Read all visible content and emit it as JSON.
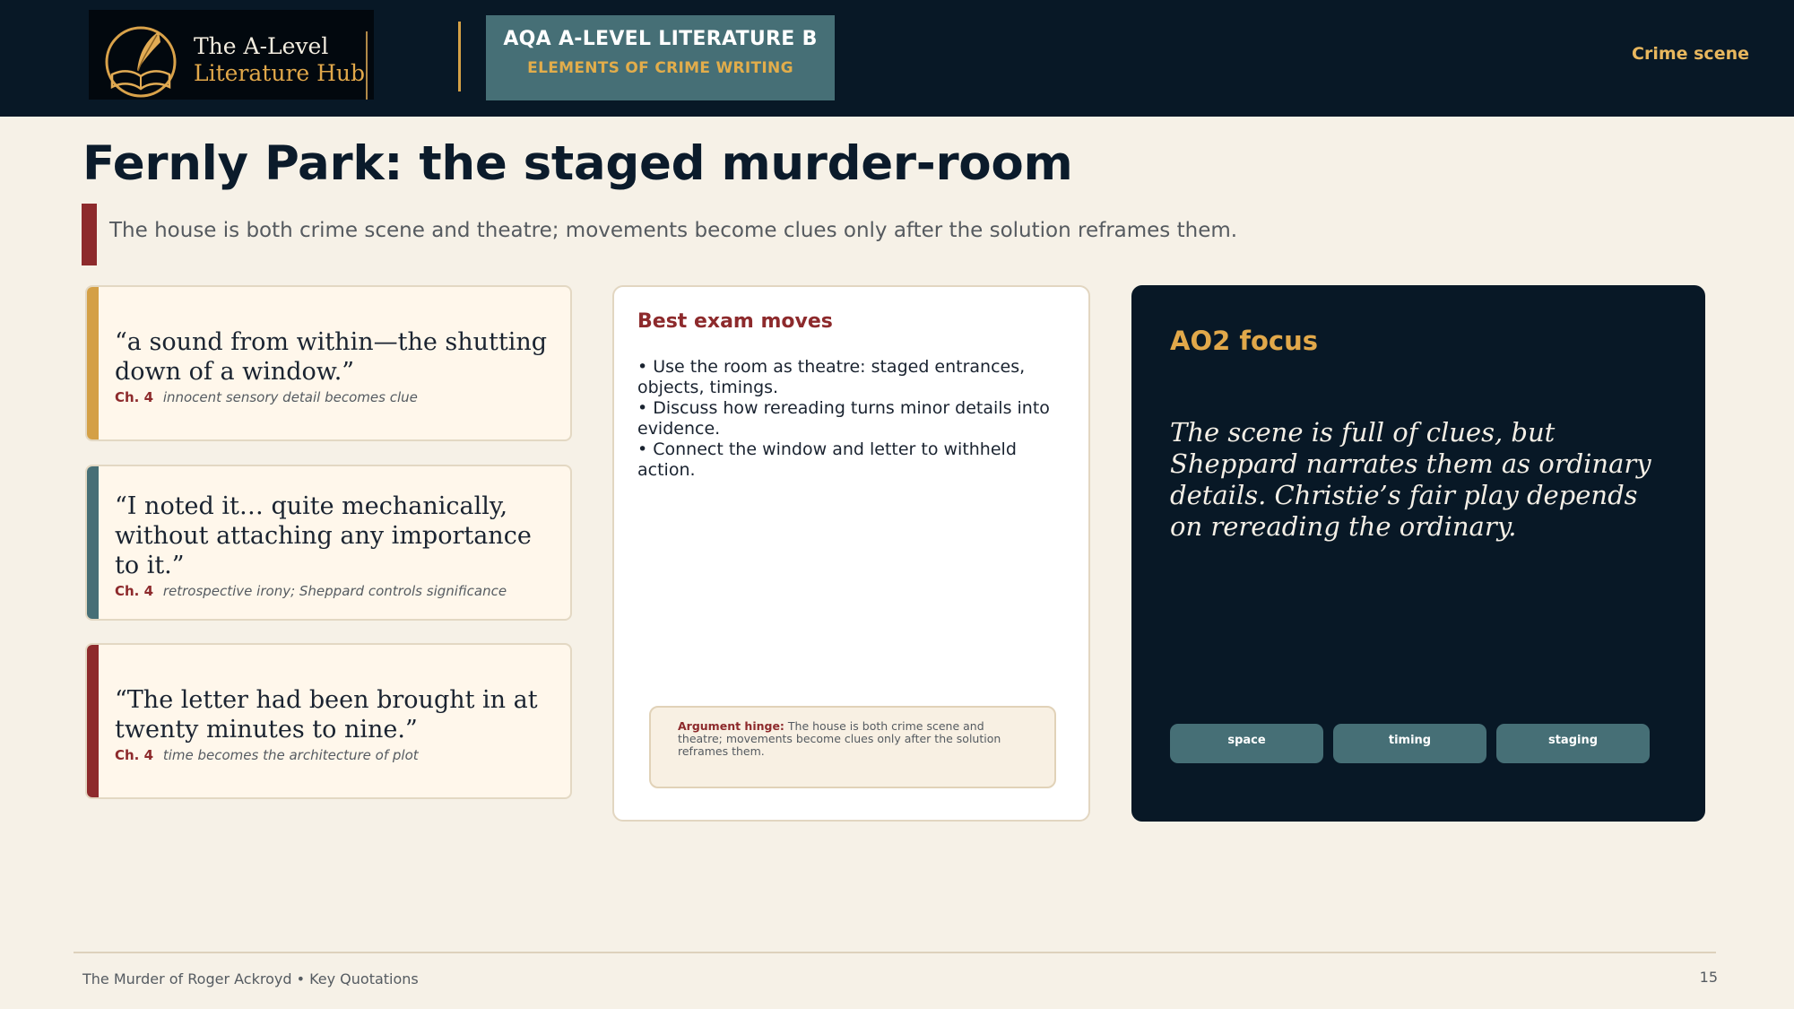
{
  "header": {
    "logo": {
      "line1": "The A-Level",
      "line2": "Literature Hub"
    },
    "course_title": "AQA A-LEVEL LITERATURE B",
    "course_subtitle": "ELEMENTS OF CRIME WRITING",
    "section_tag": "Crime scene"
  },
  "slide": {
    "title": "Fernly Park: the staged murder-room",
    "subtitle": "The house is both crime scene and theatre; movements become clues only after the solution reframes them."
  },
  "quotes": [
    {
      "text": "“a sound from within—the shutting down of a window.”",
      "chapter": "Ch. 4",
      "note": "innocent sensory detail becomes clue",
      "accent": "#d4a046"
    },
    {
      "text": "“I noted it… quite mechanically, without attaching any importance to it.”",
      "chapter": "Ch. 4",
      "note": "retrospective irony; Sheppard controls significance",
      "accent": "#466f76"
    },
    {
      "text": "“The letter had been brought in at twenty minutes to nine.”",
      "chapter": "Ch. 4",
      "note": "time becomes the architecture of plot",
      "accent": "#8d2a2c"
    }
  ],
  "moves": {
    "heading": "Best exam moves",
    "items": [
      "• Use the room as theatre: staged entrances, objects, timings.",
      "• Discuss how rereading turns minor details into evidence.",
      "• Connect the window and letter to withheld action."
    ],
    "hinge_label": "Argument hinge:",
    "hinge_text": "The house is both crime scene and theatre; movements become clues only after the solution reframes them."
  },
  "ao": {
    "heading": "AO2 focus",
    "text": "The scene is full of clues, but Sheppard narrates them as ordinary details. Christie’s fair play depends on rereading the ordinary.",
    "chips": [
      "space",
      "timing",
      "staging"
    ]
  },
  "footer": {
    "source": "The Murder of Roger Ackroyd • Key Quotations",
    "page": "15"
  },
  "colors": {
    "navy": "#081826",
    "teal": "#466f76",
    "gold": "#d4a046",
    "burgundy": "#8d2a2c",
    "cream": "#f6f1e7"
  }
}
